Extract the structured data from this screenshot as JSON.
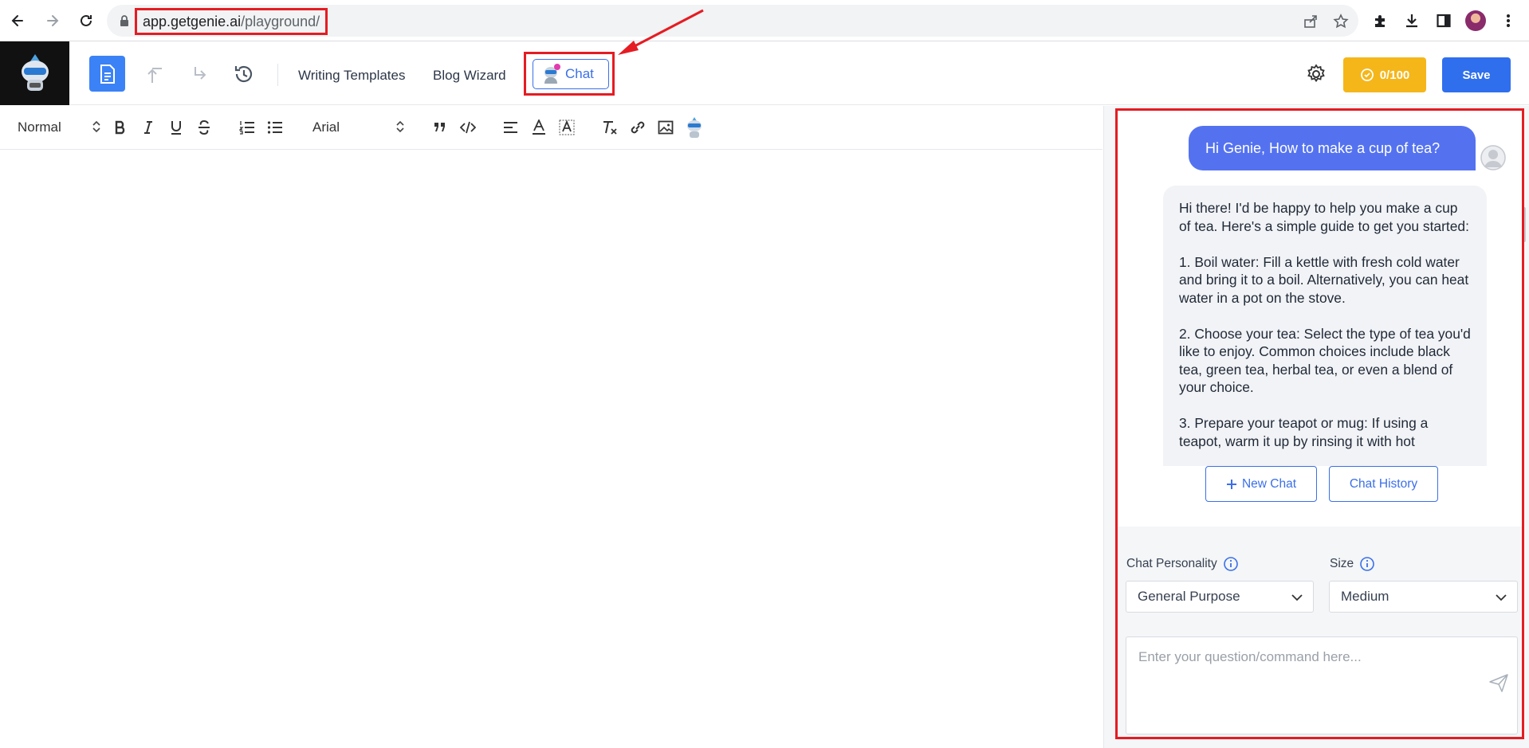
{
  "browser": {
    "url_host": "app.getgenie.ai",
    "url_path": "/playground/",
    "icons": [
      "back-icon",
      "forward-icon",
      "reload-icon",
      "lock-icon",
      "share-icon",
      "star-icon",
      "extensions-icon",
      "download-icon",
      "side-panel-icon",
      "profile-avatar",
      "menu-icon"
    ]
  },
  "toolbar": {
    "writing_templates": "Writing Templates",
    "blog_wizard": "Blog Wizard",
    "chat_label": "Chat",
    "credits": "0/100",
    "save_label": "Save",
    "icons": [
      "genie-logo",
      "document-icon",
      "undo-icon",
      "redo-icon",
      "history-icon",
      "genie-chat-icon",
      "gear-icon",
      "credits-icon"
    ]
  },
  "format_bar": {
    "block_style": "Normal",
    "font_family": "Arial",
    "icons": [
      "bold-icon",
      "italic-icon",
      "underline-icon",
      "strike-icon",
      "ordered-list-icon",
      "bullet-list-icon",
      "quote-icon",
      "code-icon",
      "align-icon",
      "text-color-icon",
      "highlight-icon",
      "clear-format-icon",
      "link-icon",
      "image-icon",
      "genie-icon"
    ]
  },
  "chat": {
    "user_message": "Hi Genie, How to make a cup of tea?",
    "ai_paragraphs": [
      "Hi there! I'd be happy to help you make a cup of tea. Here's a simple guide to get you started:",
      "1. Boil water: Fill a kettle with fresh cold water and bring it to a boil. Alternatively, you can heat water in a pot on the stove.",
      "2. Choose your tea: Select the type of tea you'd like to enjoy. Common choices include black tea, green tea, herbal tea, or even a blend of your choice.",
      "3. Prepare your teapot or mug: If using a teapot, warm it up by rinsing it with hot"
    ],
    "new_chat": "New Chat",
    "chat_history": "Chat History",
    "personality_label": "Chat Personality",
    "personality_value": "General Purpose",
    "size_label": "Size",
    "size_value": "Medium",
    "prompt_placeholder": "Enter your question/command here..."
  },
  "colors": {
    "accent": "#3b6fe8",
    "user_bubble": "#5472f0",
    "credits": "#f5b61a",
    "annotation_red": "#e51c23"
  }
}
